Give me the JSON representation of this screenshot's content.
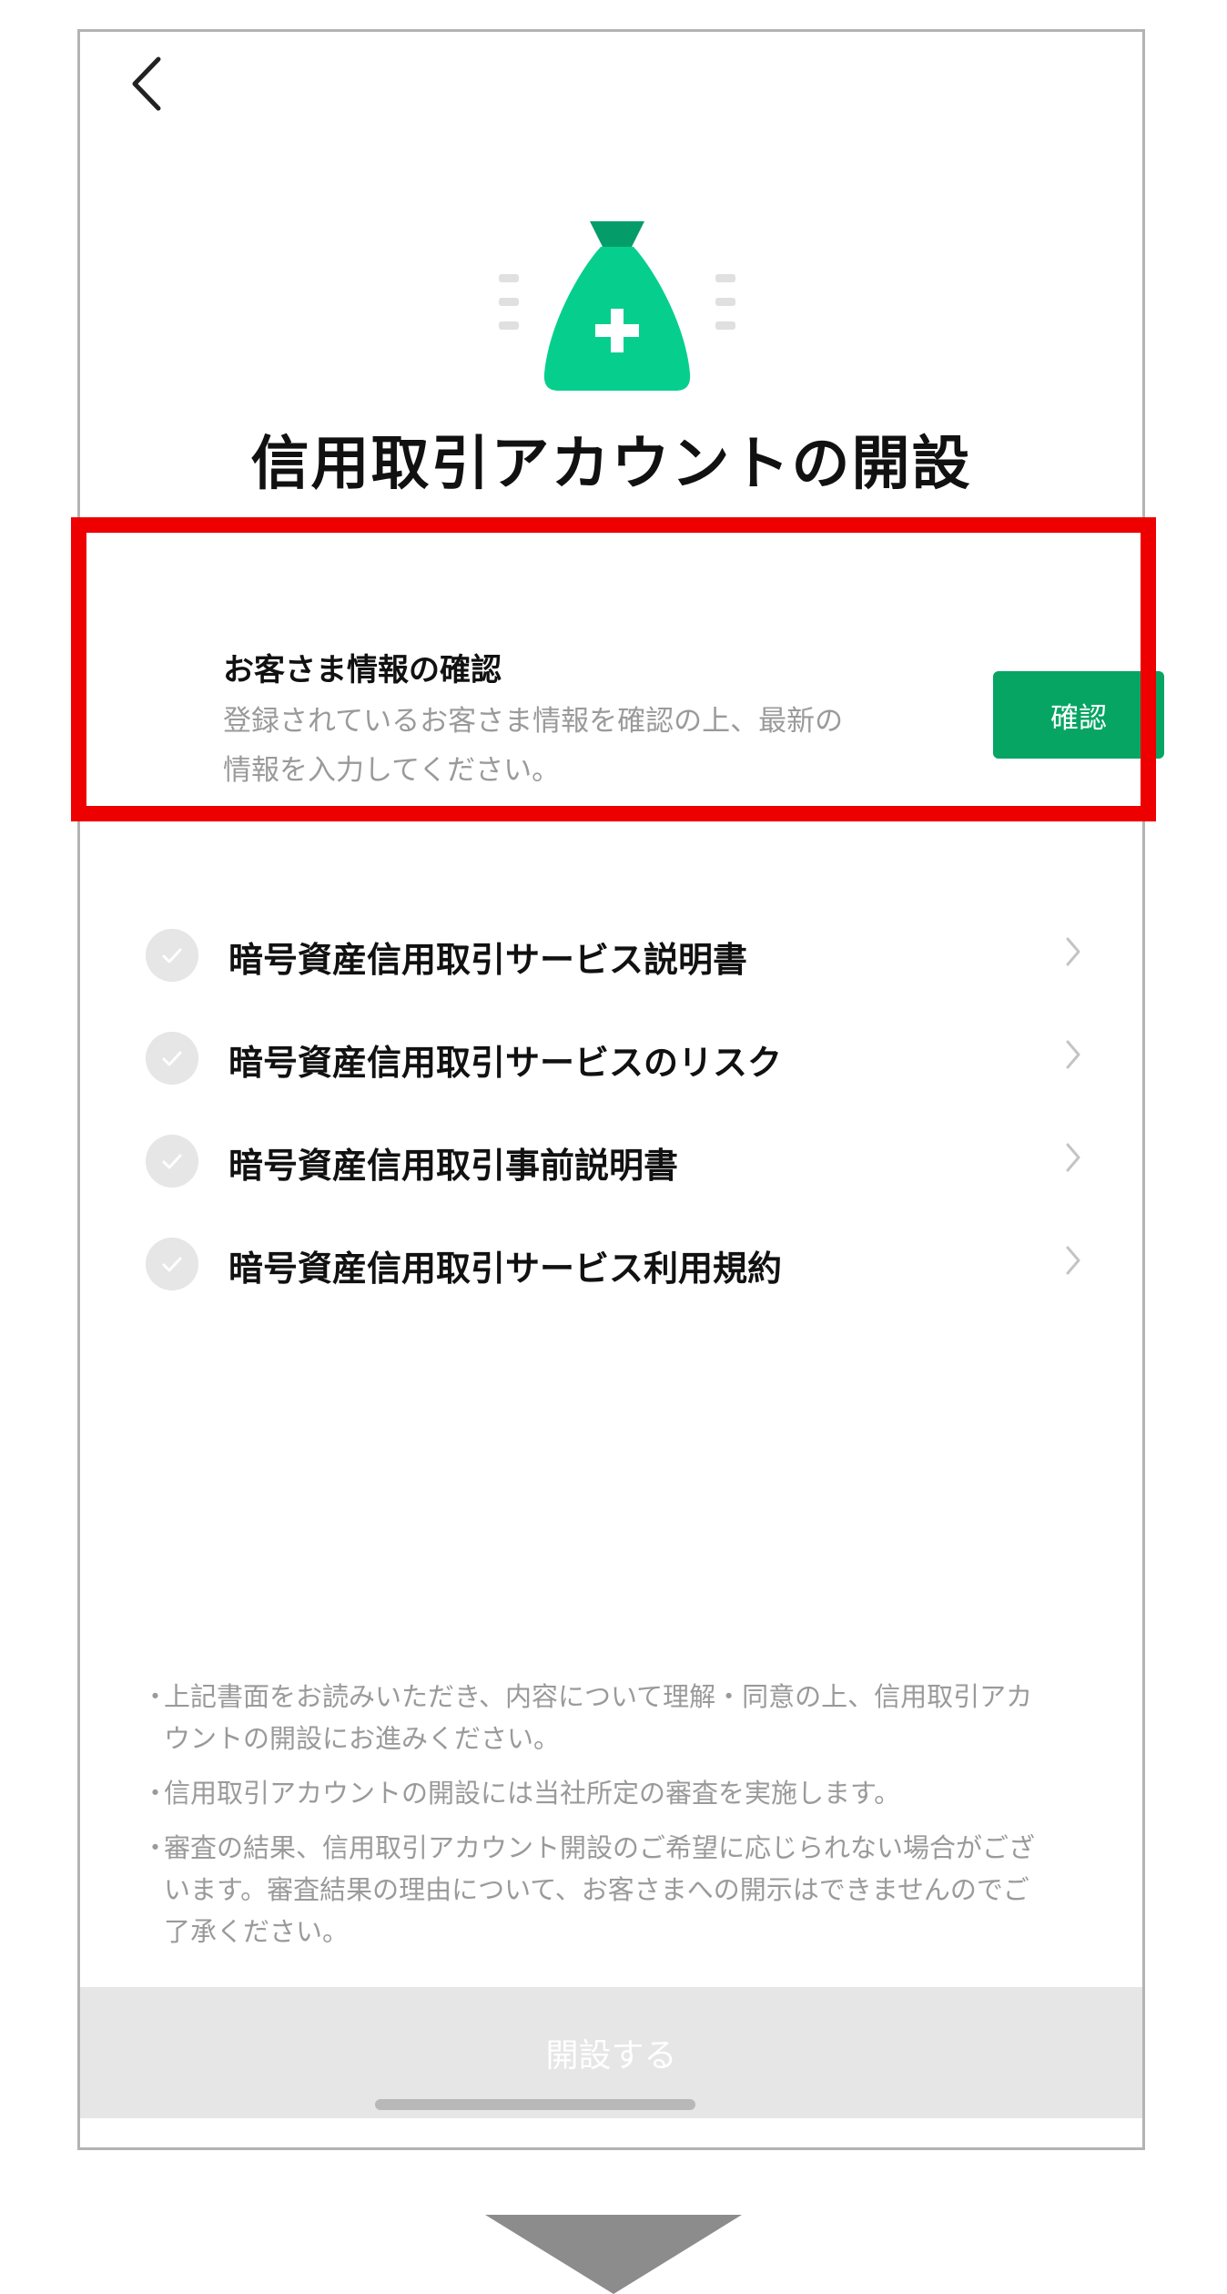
{
  "header": {
    "back_icon": "chevron-left-icon"
  },
  "hero": {
    "icon": "money-bag-plus-icon",
    "color": "#06cf8d"
  },
  "page_title": "信用取引アカウントの開設",
  "customer_info": {
    "title": "お客さま情報の確認",
    "description_line1": "登録されているお客さま情報を確認の上、最新の",
    "description_line2": "情報を入力してください。",
    "confirm_label": "確認",
    "highlight_color": "#ee0000",
    "button_color": "#06a563"
  },
  "documents": [
    {
      "label": "暗号資産信用取引サービス説明書"
    },
    {
      "label": "暗号資産信用取引サービスのリスク"
    },
    {
      "label": "暗号資産信用取引事前説明書"
    },
    {
      "label": "暗号資産信用取引サービス利用規約"
    }
  ],
  "notes": [
    {
      "bullet": "・",
      "lines": [
        "上記書面をお読みいただき、内容について理解・同意の上、信用取引アカ",
        "ウントの開設にお進みください。"
      ]
    },
    {
      "bullet": "・",
      "lines": [
        "信用取引アカウントの開設には当社所定の審査を実施します。"
      ]
    },
    {
      "bullet": "・",
      "lines": [
        "審査の結果、信用取引アカウント開設のご希望に応じられない場合がござ",
        "います。審査結果の理由について、お客さまへの開示はできませんのでご",
        "了承ください。"
      ]
    }
  ],
  "open_button": {
    "label": "開設する",
    "state": "disabled"
  }
}
